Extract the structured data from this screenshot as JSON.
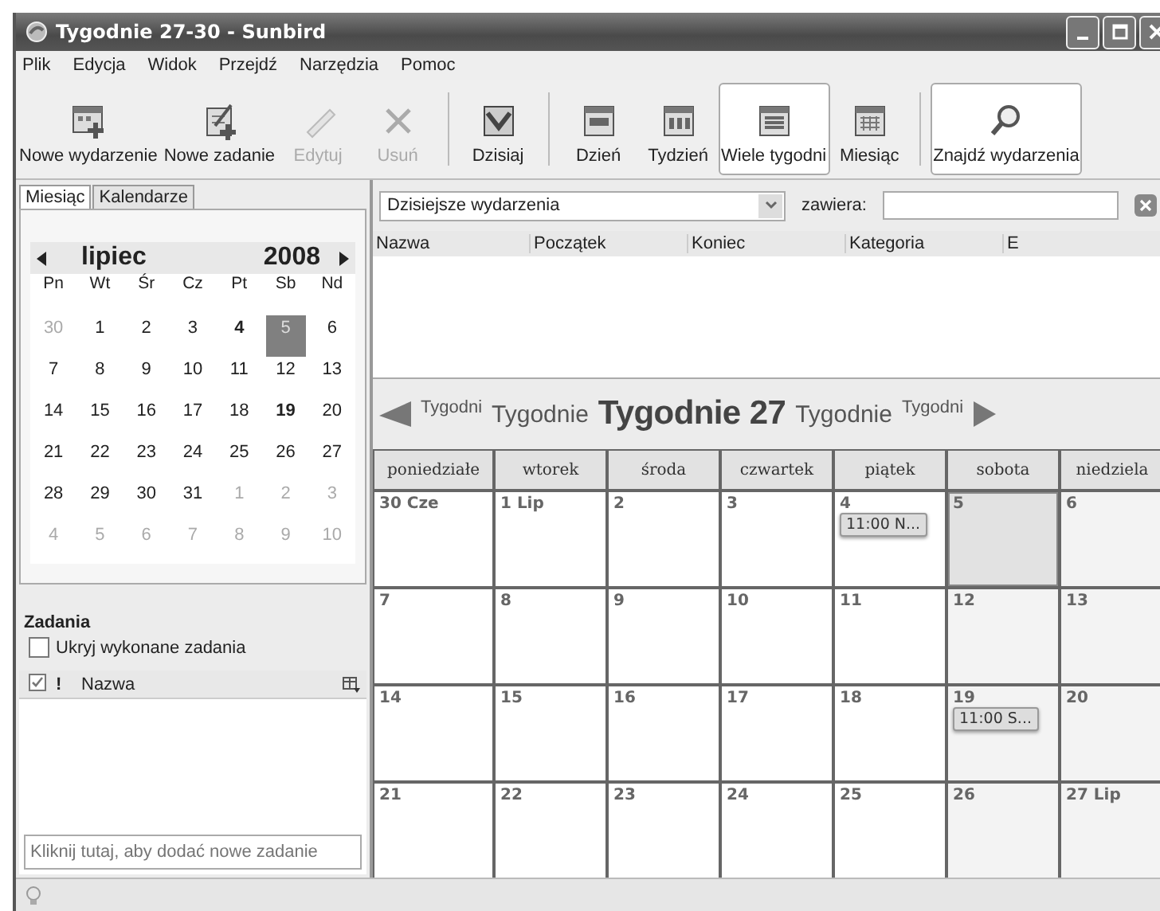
{
  "window": {
    "title": "Tygodnie 27-30 - Sunbird"
  },
  "menu": [
    "Plik",
    "Edycja",
    "Widok",
    "Przejdź",
    "Narzędzia",
    "Pomoc"
  ],
  "toolbar": [
    [
      {
        "label": "Nowe wydarzenie",
        "kind": "new-event",
        "disabled": false,
        "selected": false
      },
      {
        "label": "Nowe zadanie",
        "kind": "new-task",
        "disabled": false,
        "selected": false
      },
      {
        "label": "Edytuj",
        "kind": "edit",
        "disabled": true,
        "selected": false
      },
      {
        "label": "Usuń",
        "kind": "delete",
        "disabled": true,
        "selected": false
      }
    ],
    [
      {
        "label": "Dzisiaj",
        "kind": "today",
        "disabled": false,
        "selected": false
      }
    ],
    [
      {
        "label": "Dzień",
        "kind": "day",
        "disabled": false,
        "selected": false
      },
      {
        "label": "Tydzień",
        "kind": "week",
        "disabled": false,
        "selected": false
      },
      {
        "label": "Wiele tygodni",
        "kind": "multiweek",
        "disabled": false,
        "selected": true
      },
      {
        "label": "Miesiąc",
        "kind": "month",
        "disabled": false,
        "selected": false
      }
    ],
    [
      {
        "label": "Znajdź wydarzenia",
        "kind": "find",
        "disabled": false,
        "selected": true
      }
    ]
  ],
  "sidebar_tabs": [
    {
      "label": "Miesiąc",
      "selected": true
    },
    {
      "label": "Kalendarze",
      "selected": false
    }
  ],
  "minimonth": {
    "month": "lipiec",
    "year": "2008",
    "weekdays": [
      "Pn",
      "Wt",
      "Śr",
      "Cz",
      "Pt",
      "Sb",
      "Nd"
    ],
    "weeks": [
      [
        {
          "day": "30",
          "other_month": true,
          "bold": false,
          "selected": false
        },
        {
          "day": "1",
          "other_month": false,
          "bold": false,
          "selected": false
        },
        {
          "day": "2",
          "other_month": false,
          "bold": false,
          "selected": false
        },
        {
          "day": "3",
          "other_month": false,
          "bold": false,
          "selected": false
        },
        {
          "day": "4",
          "other_month": false,
          "bold": true,
          "selected": false
        },
        {
          "day": "5",
          "other_month": false,
          "bold": false,
          "selected": true
        },
        {
          "day": "6",
          "other_month": false,
          "bold": false,
          "selected": false
        }
      ],
      [
        {
          "day": "7",
          "other_month": false,
          "bold": false,
          "selected": false
        },
        {
          "day": "8",
          "other_month": false,
          "bold": false,
          "selected": false
        },
        {
          "day": "9",
          "other_month": false,
          "bold": false,
          "selected": false
        },
        {
          "day": "10",
          "other_month": false,
          "bold": false,
          "selected": false
        },
        {
          "day": "11",
          "other_month": false,
          "bold": false,
          "selected": false
        },
        {
          "day": "12",
          "other_month": false,
          "bold": false,
          "selected": false
        },
        {
          "day": "13",
          "other_month": false,
          "bold": false,
          "selected": false
        }
      ],
      [
        {
          "day": "14",
          "other_month": false,
          "bold": false,
          "selected": false
        },
        {
          "day": "15",
          "other_month": false,
          "bold": false,
          "selected": false
        },
        {
          "day": "16",
          "other_month": false,
          "bold": false,
          "selected": false
        },
        {
          "day": "17",
          "other_month": false,
          "bold": false,
          "selected": false
        },
        {
          "day": "18",
          "other_month": false,
          "bold": false,
          "selected": false
        },
        {
          "day": "19",
          "other_month": false,
          "bold": true,
          "selected": false
        },
        {
          "day": "20",
          "other_month": false,
          "bold": false,
          "selected": false
        }
      ],
      [
        {
          "day": "21",
          "other_month": false,
          "bold": false,
          "selected": false
        },
        {
          "day": "22",
          "other_month": false,
          "bold": false,
          "selected": false
        },
        {
          "day": "23",
          "other_month": false,
          "bold": false,
          "selected": false
        },
        {
          "day": "24",
          "other_month": false,
          "bold": false,
          "selected": false
        },
        {
          "day": "25",
          "other_month": false,
          "bold": false,
          "selected": false
        },
        {
          "day": "26",
          "other_month": false,
          "bold": false,
          "selected": false
        },
        {
          "day": "27",
          "other_month": false,
          "bold": false,
          "selected": false
        }
      ],
      [
        {
          "day": "28",
          "other_month": false,
          "bold": false,
          "selected": false
        },
        {
          "day": "29",
          "other_month": false,
          "bold": false,
          "selected": false
        },
        {
          "day": "30",
          "other_month": false,
          "bold": false,
          "selected": false
        },
        {
          "day": "31",
          "other_month": false,
          "bold": false,
          "selected": false
        },
        {
          "day": "1",
          "other_month": true,
          "bold": false,
          "selected": false
        },
        {
          "day": "2",
          "other_month": true,
          "bold": false,
          "selected": false
        },
        {
          "day": "3",
          "other_month": true,
          "bold": false,
          "selected": false
        }
      ],
      [
        {
          "day": "4",
          "other_month": true,
          "bold": false,
          "selected": false
        },
        {
          "day": "5",
          "other_month": true,
          "bold": false,
          "selected": false
        },
        {
          "day": "6",
          "other_month": true,
          "bold": false,
          "selected": false
        },
        {
          "day": "7",
          "other_month": true,
          "bold": false,
          "selected": false
        },
        {
          "day": "8",
          "other_month": true,
          "bold": false,
          "selected": false
        },
        {
          "day": "9",
          "other_month": true,
          "bold": false,
          "selected": false
        },
        {
          "day": "10",
          "other_month": true,
          "bold": false,
          "selected": false
        }
      ]
    ]
  },
  "tasks": {
    "title": "Zadania",
    "hide_completed": {
      "label": "Ukryj wykonane zadania",
      "checked": false
    },
    "columns": [
      "!",
      "Nazwa"
    ],
    "placeholder": "Kliknij tutaj, aby dodać nowe zadanie"
  },
  "filter": {
    "select": "Dzisiejsze wydarzenia",
    "contains_label": "zawiera:",
    "columns": [
      "Nazwa",
      "Początek",
      "Koniec",
      "Kategoria",
      "E"
    ]
  },
  "week_nav": [
    {
      "label": "Tygodni",
      "kind": "far"
    },
    {
      "label": "Tygodnie",
      "kind": "near"
    },
    {
      "label": "Tygodnie 27",
      "kind": "current"
    },
    {
      "label": "Tygodnie",
      "kind": "near"
    },
    {
      "label": "Tygodni",
      "kind": "far"
    }
  ],
  "day_headers": [
    "poniedziałe",
    "wtorek",
    "środa",
    "czwartek",
    "piątek",
    "sobota",
    "niedziela"
  ],
  "weeks": [
    [
      {
        "date": "30 Cze",
        "weekend": false,
        "selected": false
      },
      {
        "date": "1 Lip",
        "weekend": false,
        "selected": false
      },
      {
        "date": "2",
        "weekend": false,
        "selected": false
      },
      {
        "date": "3",
        "weekend": false,
        "selected": false
      },
      {
        "date": "4",
        "weekend": false,
        "selected": false,
        "events": [
          "11:00 N..."
        ]
      },
      {
        "date": "5",
        "weekend": true,
        "selected": true
      },
      {
        "date": "6",
        "weekend": true,
        "selected": false
      }
    ],
    [
      {
        "date": "7",
        "weekend": false,
        "selected": false
      },
      {
        "date": "8",
        "weekend": false,
        "selected": false
      },
      {
        "date": "9",
        "weekend": false,
        "selected": false
      },
      {
        "date": "10",
        "weekend": false,
        "selected": false
      },
      {
        "date": "11",
        "weekend": false,
        "selected": false
      },
      {
        "date": "12",
        "weekend": true,
        "selected": false
      },
      {
        "date": "13",
        "weekend": true,
        "selected": false
      }
    ],
    [
      {
        "date": "14",
        "weekend": false,
        "selected": false
      },
      {
        "date": "15",
        "weekend": false,
        "selected": false
      },
      {
        "date": "16",
        "weekend": false,
        "selected": false
      },
      {
        "date": "17",
        "weekend": false,
        "selected": false
      },
      {
        "date": "18",
        "weekend": false,
        "selected": false
      },
      {
        "date": "19",
        "weekend": true,
        "selected": false,
        "events": [
          "11:00 S..."
        ]
      },
      {
        "date": "20",
        "weekend": true,
        "selected": false
      }
    ],
    [
      {
        "date": "21",
        "weekend": false,
        "selected": false
      },
      {
        "date": "22",
        "weekend": false,
        "selected": false
      },
      {
        "date": "23",
        "weekend": false,
        "selected": false
      },
      {
        "date": "24",
        "weekend": false,
        "selected": false
      },
      {
        "date": "25",
        "weekend": false,
        "selected": false
      },
      {
        "date": "26",
        "weekend": true,
        "selected": false
      },
      {
        "date": "27 Lip",
        "weekend": true,
        "selected": false
      }
    ]
  ]
}
